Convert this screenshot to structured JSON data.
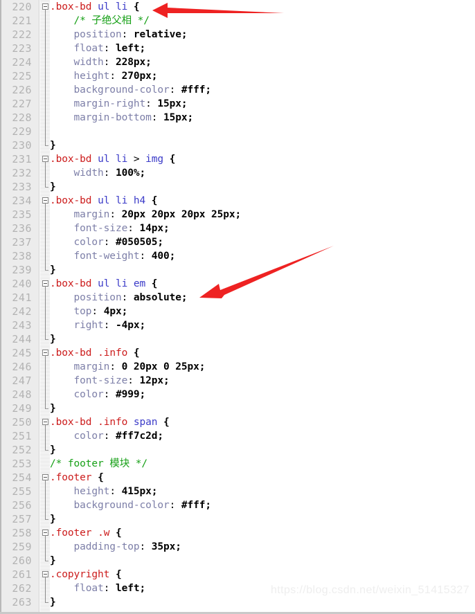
{
  "editor": {
    "app": "code-editor",
    "language": "css",
    "first_line": 220,
    "last_line": 263,
    "colors": {
      "background": "#ffffff",
      "gutter": "#ececec",
      "lineno": "#b3b3b3",
      "selector": "#cc1c1c",
      "tag": "#3b3bc8",
      "comment": "#17a017",
      "property": "#7d7fa8",
      "value": "#000000",
      "arrow": "#ee2222",
      "watermark": "#eeeeee"
    }
  },
  "lines": [
    {
      "n": "220",
      "fold": "start",
      "tokens": [
        {
          "t": ".box-bd",
          "c": "sel"
        },
        {
          "t": " ",
          "c": "plain"
        },
        {
          "t": "ul li",
          "c": "tag"
        },
        {
          "t": " ",
          "c": "plain"
        },
        {
          "t": "{",
          "c": "punc"
        }
      ]
    },
    {
      "n": "221",
      "fold": "mid",
      "indent": 4,
      "tokens": [
        {
          "t": "/* 子绝父相 */",
          "c": "com"
        }
      ]
    },
    {
      "n": "222",
      "fold": "mid",
      "indent": 4,
      "tokens": [
        {
          "t": "position",
          "c": "prop"
        },
        {
          "t": ": ",
          "c": "plain"
        },
        {
          "t": "relative",
          "c": "val"
        },
        {
          "t": ";",
          "c": "punc"
        }
      ]
    },
    {
      "n": "223",
      "fold": "mid",
      "indent": 4,
      "tokens": [
        {
          "t": "float",
          "c": "prop"
        },
        {
          "t": ": ",
          "c": "plain"
        },
        {
          "t": "left",
          "c": "val"
        },
        {
          "t": ";",
          "c": "punc"
        }
      ]
    },
    {
      "n": "224",
      "fold": "mid",
      "indent": 4,
      "tokens": [
        {
          "t": "width",
          "c": "prop"
        },
        {
          "t": ": ",
          "c": "plain"
        },
        {
          "t": "228px",
          "c": "val"
        },
        {
          "t": ";",
          "c": "punc"
        }
      ]
    },
    {
      "n": "225",
      "fold": "mid",
      "indent": 4,
      "tokens": [
        {
          "t": "height",
          "c": "prop"
        },
        {
          "t": ": ",
          "c": "plain"
        },
        {
          "t": "270px",
          "c": "val"
        },
        {
          "t": ";",
          "c": "punc"
        }
      ]
    },
    {
      "n": "226",
      "fold": "mid",
      "indent": 4,
      "tokens": [
        {
          "t": "background-color",
          "c": "prop"
        },
        {
          "t": ": ",
          "c": "plain"
        },
        {
          "t": "#fff",
          "c": "val"
        },
        {
          "t": ";",
          "c": "punc"
        }
      ]
    },
    {
      "n": "227",
      "fold": "mid",
      "indent": 4,
      "tokens": [
        {
          "t": "margin-right",
          "c": "prop"
        },
        {
          "t": ": ",
          "c": "plain"
        },
        {
          "t": "15px",
          "c": "val"
        },
        {
          "t": ";",
          "c": "punc"
        }
      ]
    },
    {
      "n": "228",
      "fold": "mid",
      "indent": 4,
      "tokens": [
        {
          "t": "margin-bottom",
          "c": "prop"
        },
        {
          "t": ": ",
          "c": "plain"
        },
        {
          "t": "15px",
          "c": "val"
        },
        {
          "t": ";",
          "c": "punc"
        }
      ]
    },
    {
      "n": "229",
      "fold": "mid",
      "indent": 0,
      "tokens": []
    },
    {
      "n": "230",
      "fold": "end",
      "tokens": [
        {
          "t": "}",
          "c": "punc"
        }
      ]
    },
    {
      "n": "231",
      "fold": "start",
      "tokens": [
        {
          "t": ".box-bd",
          "c": "sel"
        },
        {
          "t": " ",
          "c": "plain"
        },
        {
          "t": "ul li",
          "c": "tag"
        },
        {
          "t": " > ",
          "c": "plain"
        },
        {
          "t": "img",
          "c": "tag"
        },
        {
          "t": " ",
          "c": "plain"
        },
        {
          "t": "{",
          "c": "punc"
        }
      ]
    },
    {
      "n": "232",
      "fold": "mid",
      "indent": 4,
      "tokens": [
        {
          "t": "width",
          "c": "prop"
        },
        {
          "t": ": ",
          "c": "plain"
        },
        {
          "t": "100%",
          "c": "val"
        },
        {
          "t": ";",
          "c": "punc"
        }
      ]
    },
    {
      "n": "233",
      "fold": "end",
      "tokens": [
        {
          "t": "}",
          "c": "punc"
        }
      ]
    },
    {
      "n": "234",
      "fold": "start",
      "tokens": [
        {
          "t": ".box-bd",
          "c": "sel"
        },
        {
          "t": " ",
          "c": "plain"
        },
        {
          "t": "ul li h4",
          "c": "tag"
        },
        {
          "t": " ",
          "c": "plain"
        },
        {
          "t": "{",
          "c": "punc"
        }
      ]
    },
    {
      "n": "235",
      "fold": "mid",
      "indent": 4,
      "tokens": [
        {
          "t": "margin",
          "c": "prop"
        },
        {
          "t": ": ",
          "c": "plain"
        },
        {
          "t": "20px 20px 20px 25px",
          "c": "val"
        },
        {
          "t": ";",
          "c": "punc"
        }
      ]
    },
    {
      "n": "236",
      "fold": "mid",
      "indent": 4,
      "tokens": [
        {
          "t": "font-size",
          "c": "prop"
        },
        {
          "t": ": ",
          "c": "plain"
        },
        {
          "t": "14px",
          "c": "val"
        },
        {
          "t": ";",
          "c": "punc"
        }
      ]
    },
    {
      "n": "237",
      "fold": "mid",
      "indent": 4,
      "tokens": [
        {
          "t": "color",
          "c": "prop"
        },
        {
          "t": ": ",
          "c": "plain"
        },
        {
          "t": "#050505",
          "c": "val"
        },
        {
          "t": ";",
          "c": "punc"
        }
      ]
    },
    {
      "n": "238",
      "fold": "mid",
      "indent": 4,
      "tokens": [
        {
          "t": "font-weight",
          "c": "prop"
        },
        {
          "t": ": ",
          "c": "plain"
        },
        {
          "t": "400",
          "c": "val"
        },
        {
          "t": ";",
          "c": "punc"
        }
      ]
    },
    {
      "n": "239",
      "fold": "end",
      "tokens": [
        {
          "t": "}",
          "c": "punc"
        }
      ]
    },
    {
      "n": "240",
      "fold": "start",
      "tokens": [
        {
          "t": ".box-bd",
          "c": "sel"
        },
        {
          "t": " ",
          "c": "plain"
        },
        {
          "t": "ul li em",
          "c": "tag"
        },
        {
          "t": " ",
          "c": "plain"
        },
        {
          "t": "{",
          "c": "punc"
        }
      ]
    },
    {
      "n": "241",
      "fold": "mid",
      "indent": 4,
      "tokens": [
        {
          "t": "position",
          "c": "prop"
        },
        {
          "t": ": ",
          "c": "plain"
        },
        {
          "t": "absolute",
          "c": "val"
        },
        {
          "t": ";",
          "c": "punc"
        }
      ]
    },
    {
      "n": "242",
      "fold": "mid",
      "indent": 4,
      "tokens": [
        {
          "t": "top",
          "c": "prop"
        },
        {
          "t": ": ",
          "c": "plain"
        },
        {
          "t": "4px",
          "c": "val"
        },
        {
          "t": ";",
          "c": "punc"
        }
      ]
    },
    {
      "n": "243",
      "fold": "mid",
      "indent": 4,
      "tokens": [
        {
          "t": "right",
          "c": "prop"
        },
        {
          "t": ": ",
          "c": "plain"
        },
        {
          "t": "-4px",
          "c": "val"
        },
        {
          "t": ";",
          "c": "punc"
        }
      ]
    },
    {
      "n": "244",
      "fold": "end",
      "tokens": [
        {
          "t": "}",
          "c": "punc"
        }
      ]
    },
    {
      "n": "245",
      "fold": "start",
      "tokens": [
        {
          "t": ".box-bd",
          "c": "sel"
        },
        {
          "t": " ",
          "c": "plain"
        },
        {
          "t": ".info",
          "c": "sel"
        },
        {
          "t": " ",
          "c": "plain"
        },
        {
          "t": "{",
          "c": "punc"
        }
      ]
    },
    {
      "n": "246",
      "fold": "mid",
      "indent": 4,
      "tokens": [
        {
          "t": "margin",
          "c": "prop"
        },
        {
          "t": ": ",
          "c": "plain"
        },
        {
          "t": "0 20px 0 25px",
          "c": "val"
        },
        {
          "t": ";",
          "c": "punc"
        }
      ]
    },
    {
      "n": "247",
      "fold": "mid",
      "indent": 4,
      "tokens": [
        {
          "t": "font-size",
          "c": "prop"
        },
        {
          "t": ": ",
          "c": "plain"
        },
        {
          "t": "12px",
          "c": "val"
        },
        {
          "t": ";",
          "c": "punc"
        }
      ]
    },
    {
      "n": "248",
      "fold": "mid",
      "indent": 4,
      "tokens": [
        {
          "t": "color",
          "c": "prop"
        },
        {
          "t": ": ",
          "c": "plain"
        },
        {
          "t": "#999",
          "c": "val"
        },
        {
          "t": ";",
          "c": "punc"
        }
      ]
    },
    {
      "n": "249",
      "fold": "end",
      "tokens": [
        {
          "t": "}",
          "c": "punc"
        }
      ]
    },
    {
      "n": "250",
      "fold": "start",
      "tokens": [
        {
          "t": ".box-bd",
          "c": "sel"
        },
        {
          "t": " ",
          "c": "plain"
        },
        {
          "t": ".info",
          "c": "sel"
        },
        {
          "t": " ",
          "c": "plain"
        },
        {
          "t": "span",
          "c": "tag"
        },
        {
          "t": " ",
          "c": "plain"
        },
        {
          "t": "{",
          "c": "punc"
        }
      ]
    },
    {
      "n": "251",
      "fold": "mid",
      "indent": 4,
      "tokens": [
        {
          "t": "color",
          "c": "prop"
        },
        {
          "t": ": ",
          "c": "plain"
        },
        {
          "t": "#ff7c2d",
          "c": "val"
        },
        {
          "t": ";",
          "c": "punc"
        }
      ]
    },
    {
      "n": "252",
      "fold": "end",
      "tokens": [
        {
          "t": "}",
          "c": "punc"
        }
      ]
    },
    {
      "n": "253",
      "fold": "none",
      "tokens": [
        {
          "t": "/* footer 模块 */",
          "c": "com"
        }
      ]
    },
    {
      "n": "254",
      "fold": "start",
      "tokens": [
        {
          "t": ".footer",
          "c": "sel"
        },
        {
          "t": " ",
          "c": "plain"
        },
        {
          "t": "{",
          "c": "punc"
        }
      ]
    },
    {
      "n": "255",
      "fold": "mid",
      "indent": 4,
      "tokens": [
        {
          "t": "height",
          "c": "prop"
        },
        {
          "t": ": ",
          "c": "plain"
        },
        {
          "t": "415px",
          "c": "val"
        },
        {
          "t": ";",
          "c": "punc"
        }
      ]
    },
    {
      "n": "256",
      "fold": "mid",
      "indent": 4,
      "tokens": [
        {
          "t": "background-color",
          "c": "prop"
        },
        {
          "t": ": ",
          "c": "plain"
        },
        {
          "t": "#fff",
          "c": "val"
        },
        {
          "t": ";",
          "c": "punc"
        }
      ]
    },
    {
      "n": "257",
      "fold": "end",
      "tokens": [
        {
          "t": "}",
          "c": "punc"
        }
      ]
    },
    {
      "n": "258",
      "fold": "start",
      "tokens": [
        {
          "t": ".footer",
          "c": "sel"
        },
        {
          "t": " ",
          "c": "plain"
        },
        {
          "t": ".w",
          "c": "sel"
        },
        {
          "t": " ",
          "c": "plain"
        },
        {
          "t": "{",
          "c": "punc"
        }
      ]
    },
    {
      "n": "259",
      "fold": "mid",
      "indent": 4,
      "tokens": [
        {
          "t": "padding-top",
          "c": "prop"
        },
        {
          "t": ": ",
          "c": "plain"
        },
        {
          "t": "35px",
          "c": "val"
        },
        {
          "t": ";",
          "c": "punc"
        }
      ]
    },
    {
      "n": "260",
      "fold": "end",
      "tokens": [
        {
          "t": "}",
          "c": "punc"
        }
      ]
    },
    {
      "n": "261",
      "fold": "start",
      "tokens": [
        {
          "t": ".copyright",
          "c": "sel"
        },
        {
          "t": " ",
          "c": "plain"
        },
        {
          "t": "{",
          "c": "punc"
        }
      ]
    },
    {
      "n": "262",
      "fold": "mid",
      "indent": 4,
      "tokens": [
        {
          "t": "float",
          "c": "prop"
        },
        {
          "t": ": ",
          "c": "plain"
        },
        {
          "t": "left",
          "c": "val"
        },
        {
          "t": ";",
          "c": "punc"
        }
      ]
    },
    {
      "n": "263",
      "fold": "end",
      "tokens": [
        {
          "t": "}",
          "c": "punc"
        }
      ]
    }
  ],
  "annotations": [
    {
      "name": "arrow-line-220",
      "points_to_line": "220",
      "direction": "left",
      "color": "#ee2222"
    },
    {
      "name": "arrow-line-241",
      "points_to_line": "241",
      "direction": "down-left",
      "color": "#ee2222"
    }
  ],
  "watermark": {
    "text": "https://blog.csdn.net/weixin_51415327"
  }
}
